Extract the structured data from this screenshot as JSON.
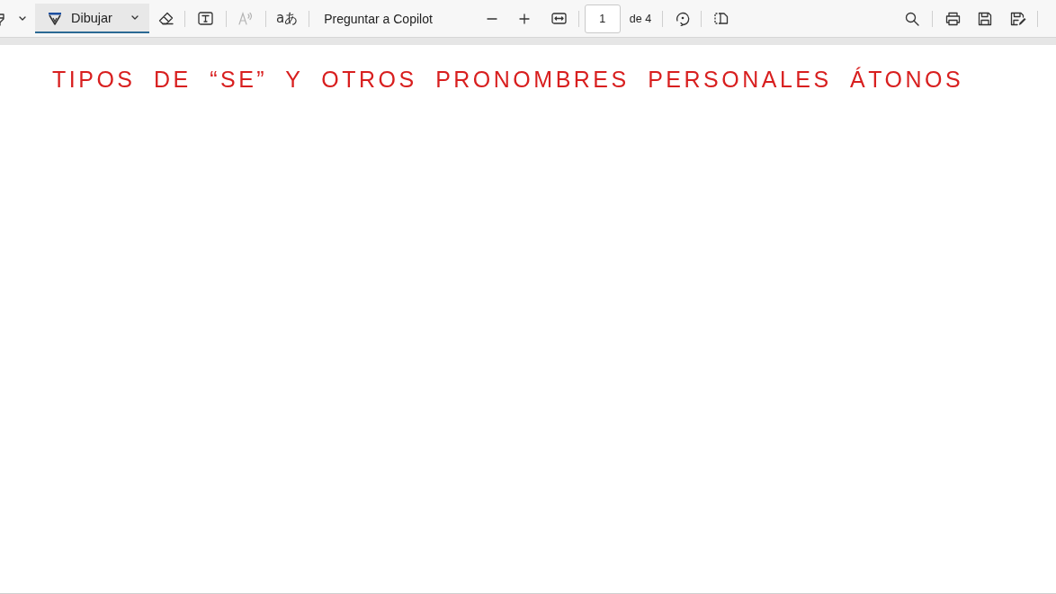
{
  "toolbar": {
    "draw_button": {
      "label": "Dibujar",
      "selected": true
    },
    "read_aloud": {
      "disabled": true
    },
    "translate_label": "aあ",
    "copilot_button": "Preguntar a Copilot",
    "page_number": "1",
    "page_count": "de 4"
  },
  "page": {
    "handwritten_title": "TIPOS DE “SE” Y OTROS PRONOMBRES PERSONALES ÁTONOS"
  }
}
